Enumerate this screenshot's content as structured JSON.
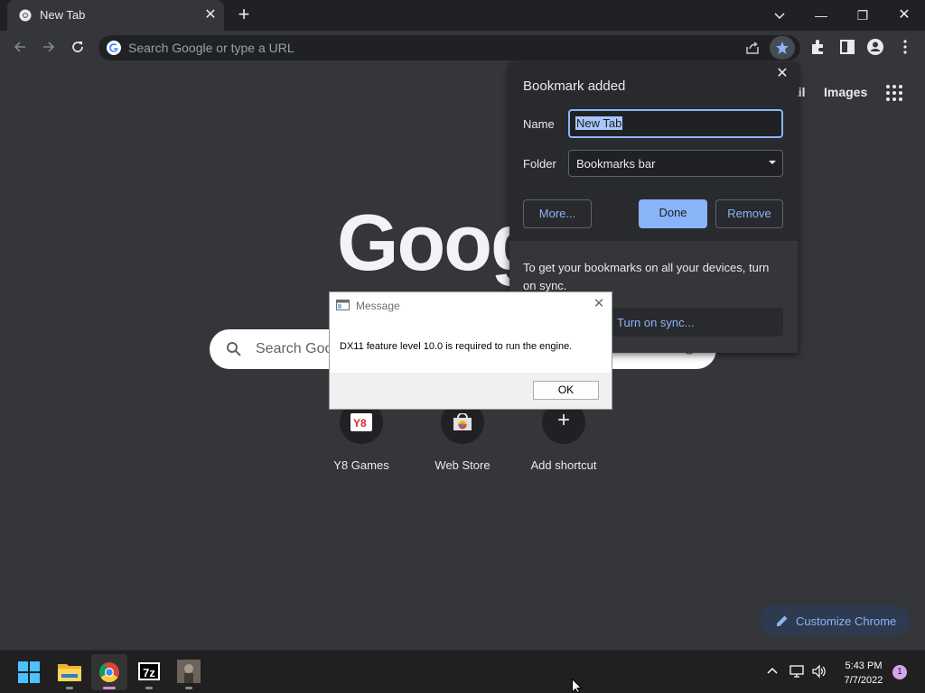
{
  "browser": {
    "tab": {
      "title": "New Tab",
      "close": "✕"
    },
    "new_tab": "+",
    "window_controls": {
      "minimize": "—",
      "restore": "❐",
      "close": "✕",
      "tab_search": "⌄"
    }
  },
  "toolbar": {
    "omnibox_placeholder": "Search Google or type a URL"
  },
  "ntp": {
    "top_links": {
      "gmail": "ail",
      "images": "Images"
    },
    "logo": "Goog",
    "search_placeholder": "Search Goo",
    "shortcuts": [
      {
        "label": "Y8 Games",
        "icon": "y8-icon"
      },
      {
        "label": "Web Store",
        "icon": "web-store-icon"
      },
      {
        "label": "Add shortcut",
        "icon": "plus-icon",
        "glyph": "+"
      }
    ],
    "customize_label": "Customize Chrome"
  },
  "bookmark_bubble": {
    "title": "Bookmark added",
    "close": "✕",
    "name_label": "Name",
    "name_value": "New Tab",
    "folder_label": "Folder",
    "folder_value": "Bookmarks bar",
    "more_button": "More...",
    "done_button": "Done",
    "remove_button": "Remove",
    "sync_text": "To get your bookmarks on all your devices, turn on sync.",
    "sync_button": "Turn on sync..."
  },
  "message_dialog": {
    "title": "Message",
    "close": "✕",
    "text": "DX11 feature level 10.0 is required to run the engine.",
    "ok_button": "OK"
  },
  "taskbar": {
    "time": "5:43 PM",
    "date": "7/7/2022",
    "notification_count": "1",
    "apps": [
      "start-icon",
      "file-explorer-icon",
      "chrome-icon",
      "7zip-icon",
      "game-icon"
    ],
    "seven_zip_text": "7z"
  },
  "colors": {
    "accent": "#8ab4f8",
    "chrome_bg": "#35363a",
    "tabstrip_bg": "#202124"
  }
}
